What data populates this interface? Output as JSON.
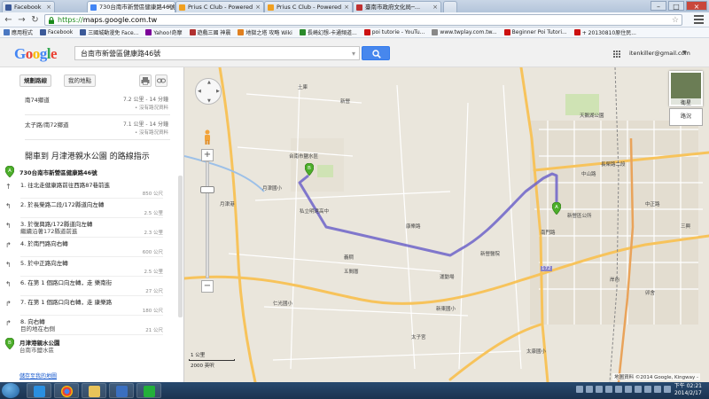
{
  "browser": {
    "tabs": [
      {
        "title": "Facebook",
        "favicon_color": "#3b5998",
        "active": false
      },
      {
        "title": "730台南市新營區健康路46號",
        "favicon_color": "#4285f4",
        "active": true
      },
      {
        "title": "Prius C Club - Powered",
        "favicon_color": "#f0a020",
        "active": false
      },
      {
        "title": "Prius C Club - Powered",
        "favicon_color": "#f0a020",
        "active": false
      },
      {
        "title": "臺南市政府文化局─...",
        "favicon_color": "#c03030",
        "active": false
      }
    ],
    "url_scheme": "https://",
    "url_host": "maps.google.com.tw",
    "bookmarks": [
      {
        "label": "應用程式",
        "color": "#4a78c2"
      },
      {
        "label": "Facebook",
        "color": "#3b5998"
      },
      {
        "label": "三國城動漫免 Face...",
        "color": "#3b5998"
      },
      {
        "label": "Yahoo!奇摩",
        "color": "#7b0099"
      },
      {
        "label": "遊戲三國 神晨",
        "color": "#b03030"
      },
      {
        "label": "地獄之塔 攻略 Wiki",
        "color": "#e08020"
      },
      {
        "label": "長崎幻想-卡通頻道...",
        "color": "#2a8a2a"
      },
      {
        "label": "poi tutorie - YouTu...",
        "color": "#cc1111"
      },
      {
        "label": "www.twplay.com.tw...",
        "color": "#888888"
      },
      {
        "label": "Beginner Poi Tutori...",
        "color": "#cc1111"
      },
      {
        "label": "+ 20130810原住民...",
        "color": "#cc1111"
      }
    ]
  },
  "google": {
    "logo": "Google",
    "search_value": "台南市新營區健康路46號",
    "account": "itenkiller@gmail.com"
  },
  "panel": {
    "btn_directions": "規劃路線",
    "btn_traffic": "我的地點",
    "alt_routes": [
      {
        "name": "南74鄉道",
        "dist": "7.2 公里 - 14 分鐘",
        "note": "• 沒有路況資料"
      },
      {
        "name": "太子路/南72鄉道",
        "dist": "7.1 公里 - 14 分鐘",
        "note": "• 沒有路況資料"
      }
    ],
    "title": "開車到 月津港親水公園 的路線指示",
    "from": "730台南市新營區健康路46號",
    "steps": [
      {
        "arrow": "↑",
        "text": "1. 往北走健康路前往西路87巷前進",
        "sub": "",
        "dist": "850 公尺"
      },
      {
        "arrow": "↰",
        "text": "2. 於長榮路二段/172縣道向左轉",
        "sub": "",
        "dist": "2.5 公里"
      },
      {
        "arrow": "↰",
        "text": "3. 於復興路/172縣道向左轉",
        "sub": "繼續沿著172縣道前進",
        "dist": "2.3 公里"
      },
      {
        "arrow": "↱",
        "text": "4. 於南門路向右轉",
        "sub": "",
        "dist": "600 公尺"
      },
      {
        "arrow": "↰",
        "text": "5. 於中正路向左轉",
        "sub": "",
        "dist": "2.5 公里"
      },
      {
        "arrow": "↰",
        "text": "6. 在第 1 個路口向左轉，走 樂南街",
        "sub": "",
        "dist": "27 公尺"
      },
      {
        "arrow": "↱",
        "text": "7. 在第 1 個路口向右轉，走 康樂路",
        "sub": "",
        "dist": "180 公尺"
      },
      {
        "arrow": "↱",
        "text": "8. 向右轉",
        "sub": "目的地在右側",
        "dist": "21 公尺"
      }
    ],
    "to": "月津港親水公園",
    "to_sub": "台南市鹽水區",
    "link": "儲存至我的地圖"
  },
  "map": {
    "labels": [
      {
        "text": "土庫"
      },
      {
        "text": "新營"
      },
      {
        "text": "天鵝湖公園"
      },
      {
        "text": "中山路"
      },
      {
        "text": "中正路"
      },
      {
        "text": "長榮路二段"
      },
      {
        "text": "新營區公所"
      },
      {
        "text": "台南市鹽水區"
      },
      {
        "text": "月津國小"
      },
      {
        "text": "月津港"
      },
      {
        "text": "私立明達高中"
      },
      {
        "text": "康樂路"
      },
      {
        "text": "義稠"
      },
      {
        "text": "五間厝"
      },
      {
        "text": "新營醫院"
      },
      {
        "text": "運動場"
      },
      {
        "text": "太子宮"
      },
      {
        "text": "太康國小"
      },
      {
        "text": "新東國小"
      },
      {
        "text": "仁光國小"
      },
      {
        "text": "岸內"
      },
      {
        "text": "卯舍"
      },
      {
        "text": "三興"
      },
      {
        "text": "南門路"
      },
      {
        "text": "172"
      }
    ],
    "satellite": "衛星",
    "traffic": "路況",
    "scale_km": "1 公里",
    "scale_ft": "2000 英呎",
    "copyright": "地圖資料 ©2014 Google, Kingway -"
  },
  "taskbar": {
    "time": "下午 02:21",
    "date": "2014/2/17"
  }
}
